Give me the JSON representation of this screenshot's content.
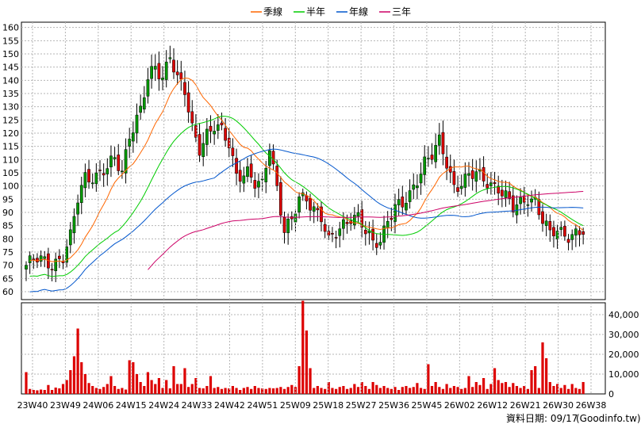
{
  "chart_data": {
    "type": "candlestick",
    "legend": [
      {
        "name": "季線",
        "color": "#ff6600"
      },
      {
        "name": "半年",
        "color": "#00cc00"
      },
      {
        "name": "年線",
        "color": "#0055cc"
      },
      {
        "name": "三年",
        "color": "#cc0066"
      }
    ],
    "price_ylim": [
      57,
      162
    ],
    "price_yticks": [
      60,
      65,
      70,
      75,
      80,
      85,
      90,
      95,
      100,
      105,
      110,
      115,
      120,
      125,
      130,
      135,
      140,
      145,
      150,
      155,
      160
    ],
    "volume_ylim": [
      0,
      46000
    ],
    "volume_yticks": [
      0,
      10000,
      20000,
      30000,
      40000
    ],
    "volume_ytick_labels": [
      "0",
      "10,000",
      "20,000",
      "30,000",
      "40,000"
    ],
    "x_labels": [
      "23W40",
      "23W49",
      "24W06",
      "24W15",
      "24W24",
      "24W33",
      "24W42",
      "24W51",
      "25W09",
      "25W18",
      "25W27",
      "25W36",
      "25W45",
      "26W02",
      "26W12",
      "26W21",
      "26W30",
      "26W38"
    ],
    "up_color": "#009900",
    "down_color": "#dd0000",
    "volume_color": "#dd0000",
    "anchors": [
      [
        0,
        70
      ],
      [
        3,
        72
      ],
      [
        7,
        71
      ],
      [
        10,
        73
      ],
      [
        12,
        80
      ],
      [
        14,
        95
      ],
      [
        16,
        104
      ],
      [
        19,
        104
      ],
      [
        22,
        106
      ],
      [
        24,
        110
      ],
      [
        26,
        106
      ],
      [
        28,
        120
      ],
      [
        31,
        128
      ],
      [
        33,
        140
      ],
      [
        35,
        145
      ],
      [
        37,
        142
      ],
      [
        39,
        150
      ],
      [
        41,
        140
      ],
      [
        43,
        135
      ],
      [
        45,
        122
      ],
      [
        47,
        115
      ],
      [
        49,
        120
      ],
      [
        51,
        122
      ],
      [
        53,
        120
      ],
      [
        55,
        116
      ],
      [
        57,
        105
      ],
      [
        60,
        105
      ],
      [
        62,
        100
      ],
      [
        64,
        100
      ],
      [
        66,
        116
      ],
      [
        68,
        100
      ],
      [
        70,
        83
      ],
      [
        72,
        86
      ],
      [
        74,
        95
      ],
      [
        76,
        96
      ],
      [
        78,
        92
      ],
      [
        80,
        88
      ],
      [
        82,
        78
      ],
      [
        84,
        82
      ],
      [
        86,
        86
      ],
      [
        88,
        89
      ],
      [
        90,
        88
      ],
      [
        92,
        82
      ],
      [
        94,
        78
      ],
      [
        96,
        80
      ],
      [
        98,
        88
      ],
      [
        100,
        92
      ],
      [
        102,
        92
      ],
      [
        104,
        96
      ],
      [
        106,
        103
      ],
      [
        108,
        110
      ],
      [
        110,
        112
      ],
      [
        112,
        116
      ],
      [
        114,
        108
      ],
      [
        116,
        100
      ],
      [
        118,
        102
      ],
      [
        120,
        104
      ],
      [
        122,
        104
      ],
      [
        124,
        102
      ],
      [
        126,
        101
      ],
      [
        128,
        100
      ],
      [
        130,
        96
      ],
      [
        132,
        91
      ],
      [
        134,
        93
      ],
      [
        136,
        96
      ],
      [
        138,
        95
      ],
      [
        140,
        87
      ],
      [
        142,
        81
      ],
      [
        144,
        83
      ],
      [
        146,
        82
      ]
    ],
    "volumes": [
      11000,
      2500,
      2000,
      1800,
      2200,
      2000,
      4500,
      2000,
      3200,
      2800,
      5000,
      7000,
      12000,
      19000,
      33000,
      16000,
      10000,
      5500,
      4000,
      3000,
      2500,
      3500,
      5000,
      9000,
      4000,
      2500,
      3000,
      2200,
      17000,
      16000,
      10000,
      6000,
      4000,
      11000,
      7000,
      5000,
      8000,
      3000,
      7000,
      2800,
      14000,
      5000,
      5000,
      13000,
      3500,
      5000,
      8000,
      3000,
      2800,
      4000,
      9000,
      3000,
      3500,
      2500,
      3000,
      2800,
      4000,
      3000,
      2000,
      3000,
      3500,
      2500,
      4000,
      3000,
      2800,
      2500,
      3000,
      2800,
      3000,
      3500,
      2500,
      3500,
      4500,
      3500,
      14000,
      47000,
      32000,
      13000,
      3000,
      4000,
      3000,
      2500,
      6000,
      3000,
      2500,
      3500,
      4000,
      2500,
      3000,
      5000,
      3500,
      6000,
      4000,
      2500,
      6000,
      4500,
      3000,
      4000,
      3000,
      2500,
      3500,
      2000,
      3500,
      4000,
      3000,
      3500,
      5500,
      3000,
      2500,
      15000,
      4000,
      6000,
      3500,
      2500,
      5000,
      3000,
      4000,
      3500,
      2500,
      3000,
      9000,
      3500,
      6000,
      4500,
      8000,
      2500,
      5000,
      13000,
      7000,
      5500,
      6000,
      3500,
      5500,
      4000,
      3000,
      4000,
      2500,
      12000,
      14000,
      3000,
      26000,
      18000,
      6000,
      4000,
      5000,
      3000,
      4500,
      2500,
      5000,
      3000,
      2500,
      6000
    ]
  },
  "footer": {
    "date_label": "資料日期: 09/17",
    "source": "(Goodinfo.tw)"
  }
}
